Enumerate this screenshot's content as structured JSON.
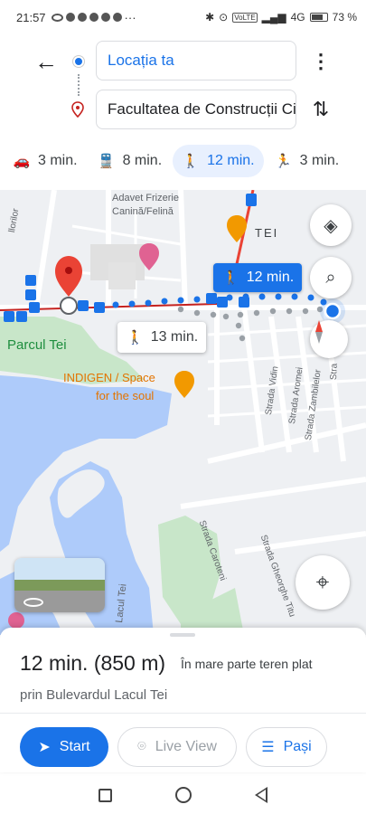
{
  "status_bar": {
    "time": "21:57",
    "battery": "73 %",
    "volte": "VoLTE",
    "network": "4G"
  },
  "header": {
    "origin": "Locația ta",
    "destination": "Facultatea de Construcții Civile"
  },
  "modes": [
    {
      "icon": "car-icon",
      "label": "3 min."
    },
    {
      "icon": "transit-icon",
      "label": "8 min."
    },
    {
      "icon": "walk-icon",
      "label": "12 min.",
      "active": true
    },
    {
      "icon": "ride-icon",
      "label": "3 min."
    }
  ],
  "map": {
    "labels": {
      "adavet": "Adavet Frizerie",
      "canina": "Canină/Felină",
      "tei": "TEI",
      "parcul": "Parcul Tei",
      "indigen1": "INDIGEN / Space",
      "indigen2": "for the soul",
      "vidin": "Strada Vidin",
      "aromei": "Strada Aromei",
      "zambilelor": "Strada Zambilelor",
      "stra": "Stra",
      "carotenii": "Strada Caroteni",
      "gheorghe": "Strada Gheorghe Titu",
      "lacul": "Lacul Tei",
      "florilor": "llorilor"
    },
    "route_primary": "12 min.",
    "route_alt": "13 min."
  },
  "sheet": {
    "duration": "12 min. (850 m)",
    "terrain": "În mare parte teren plat",
    "via": "prin Bulevardul Lacul Tei",
    "start_label": "Start",
    "live_view_label": "Live View",
    "steps_label": "Pași"
  },
  "colors": {
    "accent": "#1a73e8",
    "water": "#aecbfa",
    "park": "#c8e6c9",
    "route_red": "#ea4335"
  }
}
